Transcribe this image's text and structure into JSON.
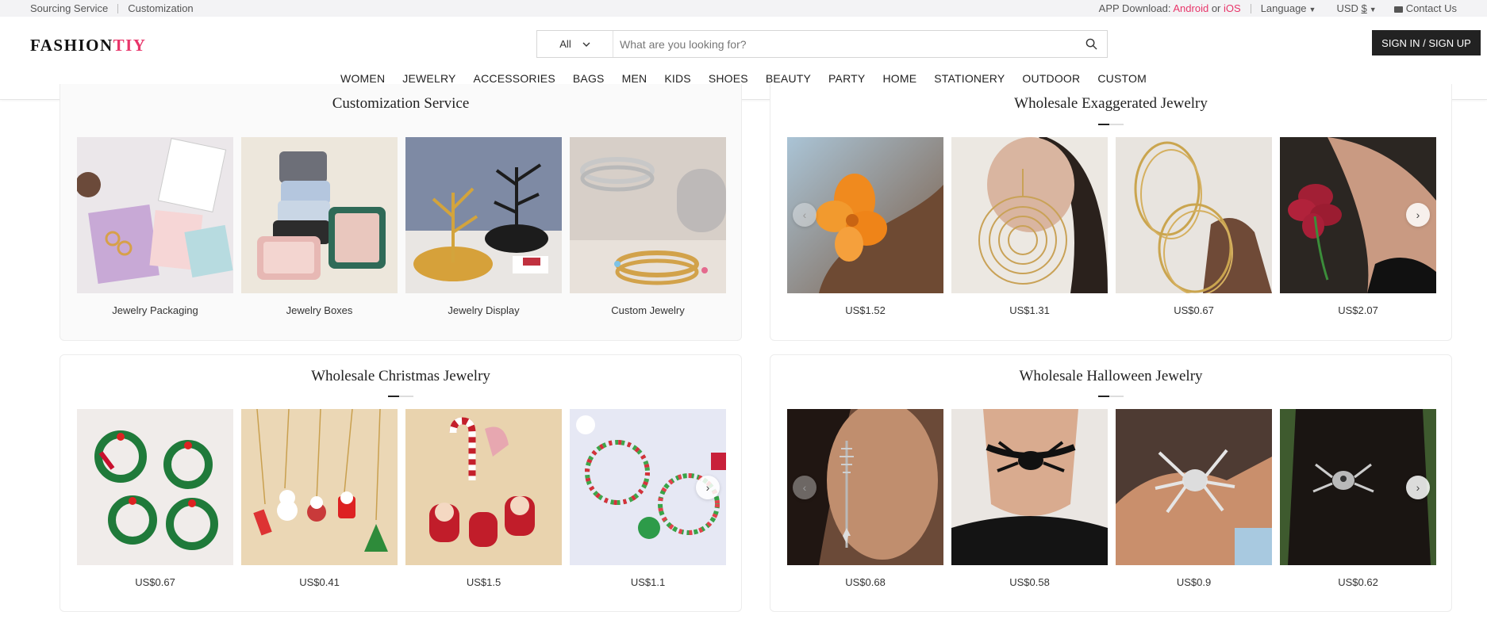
{
  "topbar": {
    "links": [
      "Sourcing Service",
      "Customization"
    ],
    "app_download": "APP Download:",
    "android": "Android",
    "or": "or",
    "ios": "iOS",
    "language": "Language",
    "currency_code": "USD",
    "currency_symbol": "$",
    "contact": "Contact Us"
  },
  "header": {
    "logo_main": "FASHION",
    "logo_accent": "TIY",
    "search_category": "All",
    "search_placeholder": "What are you looking for?",
    "signin": "SIGN IN / SIGN UP"
  },
  "nav": [
    "WOMEN",
    "JEWELRY",
    "ACCESSORIES",
    "BAGS",
    "MEN",
    "KIDS",
    "SHOES",
    "BEAUTY",
    "PARTY",
    "HOME",
    "STATIONERY",
    "OUTDOOR",
    "CUSTOM"
  ],
  "sections": {
    "customization": {
      "title": "Customization Service",
      "items": [
        "Jewelry Packaging",
        "Jewelry Boxes",
        "Jewelry Display",
        "Custom Jewelry"
      ]
    },
    "exaggerated": {
      "title": "Wholesale Exaggerated Jewelry",
      "prices": [
        "US$1.52",
        "US$1.31",
        "US$0.67",
        "US$2.07"
      ]
    },
    "christmas": {
      "title": "Wholesale Christmas Jewelry",
      "prices": [
        "US$0.67",
        "US$0.41",
        "US$1.5",
        "US$1.1"
      ]
    },
    "halloween": {
      "title": "Wholesale Halloween Jewelry",
      "prices": [
        "US$0.68",
        "US$0.58",
        "US$0.9",
        "US$0.62"
      ]
    }
  },
  "colors": {
    "accent": "#e8356a",
    "dark": "#222222"
  }
}
